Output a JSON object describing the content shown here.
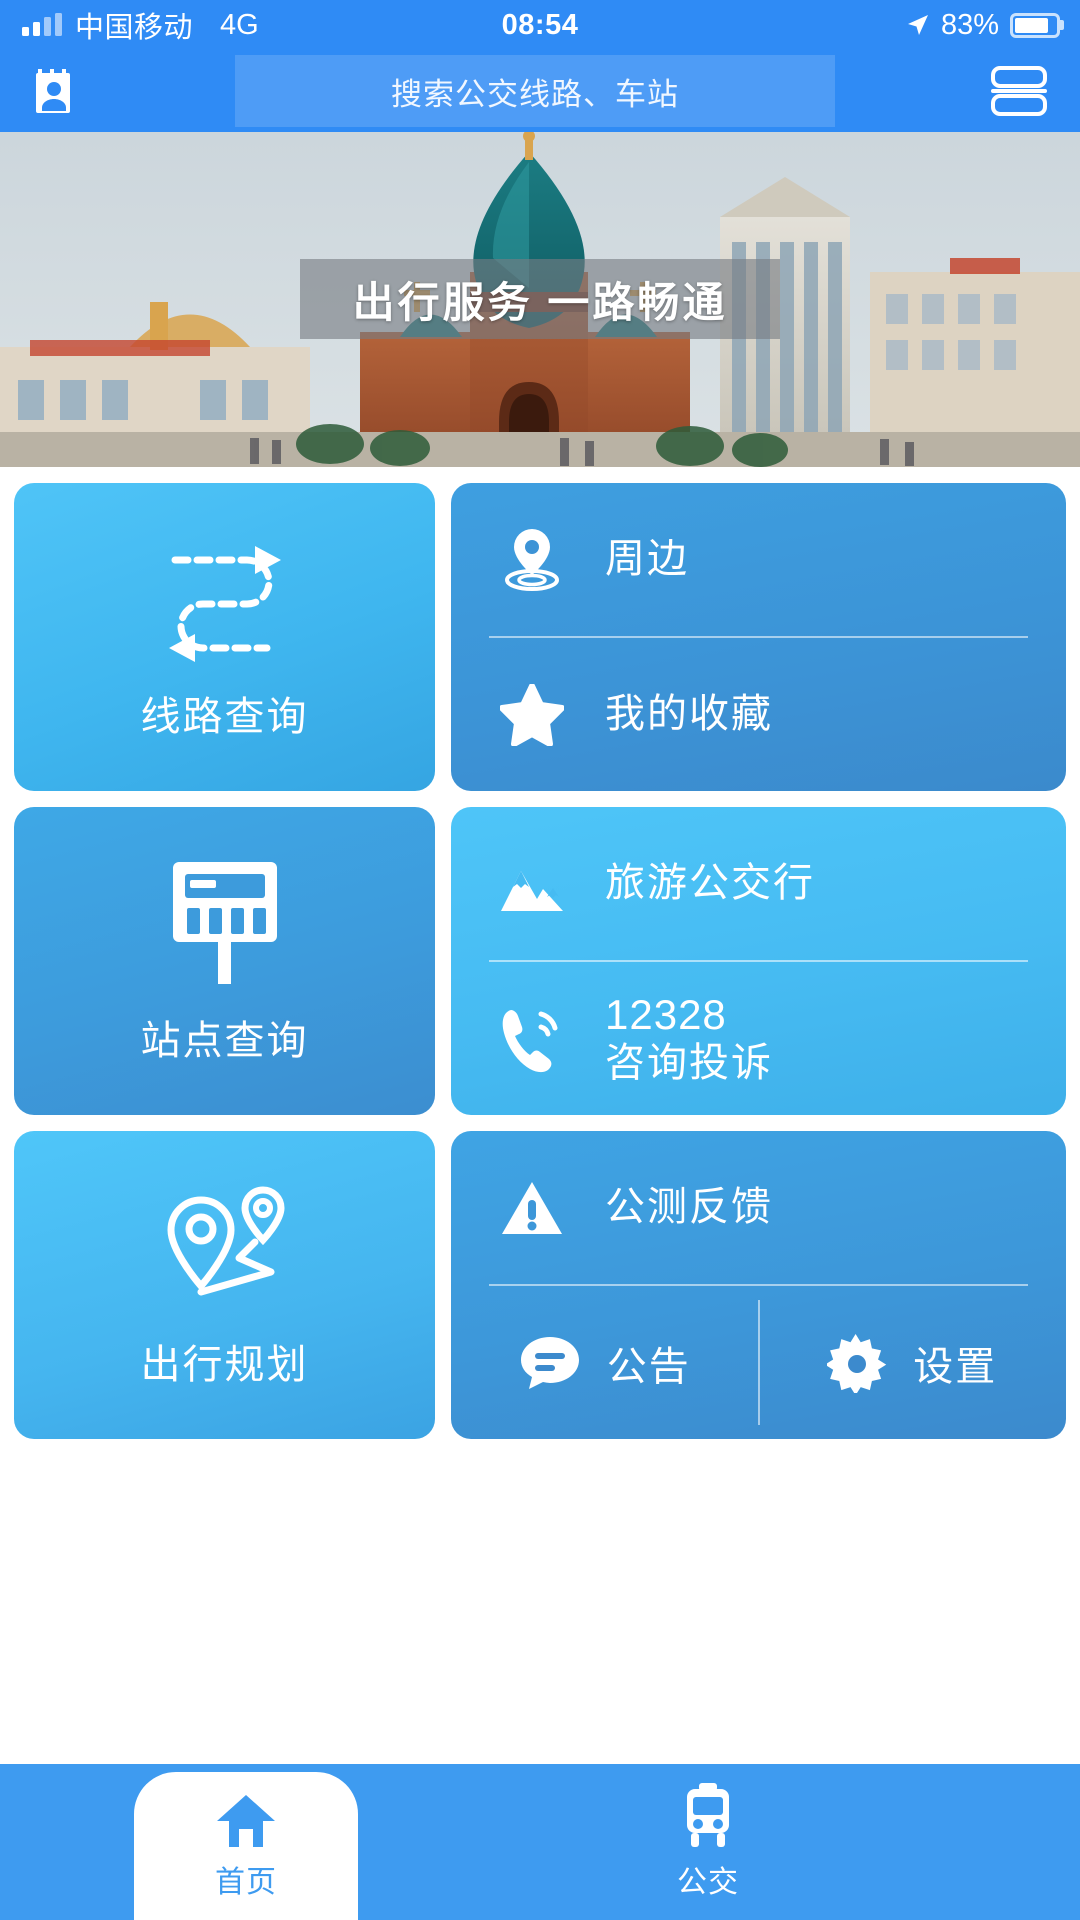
{
  "status_bar": {
    "carrier": "中国移动",
    "network": "4G",
    "time": "08:54",
    "battery_percent": "83%",
    "signal_bars": 4,
    "battery_level": 83
  },
  "header": {
    "profile_icon": "id-card-icon",
    "menu_icon": "list-menu-icon",
    "search_placeholder": "搜索公交线路、车站"
  },
  "banner": {
    "caption": "出行服务  一路畅通",
    "image_subject": "harbin-saint-sophia-cathedral"
  },
  "tiles": {
    "route_query": {
      "label": "线路查询",
      "icon": "s-route-dashed-icon"
    },
    "nearby": {
      "label": "周边",
      "icon": "location-pin-ripple-icon"
    },
    "favorites": {
      "label": "我的收藏",
      "icon": "star-icon"
    },
    "station_query": {
      "label": "站点查询",
      "icon": "bus-stop-sign-icon"
    },
    "tour_bus": {
      "label": "旅游公交行",
      "icon": "mountain-icon"
    },
    "hotline": {
      "number": "12328",
      "label": "咨询投诉",
      "icon": "phone-ring-icon"
    },
    "beta_feedback": {
      "label": "公测反馈",
      "icon": "warning-triangle-icon"
    },
    "announcements": {
      "label": "公告",
      "icon": "chat-bubble-icon"
    },
    "settings": {
      "label": "设置",
      "icon": "gear-icon"
    }
  },
  "bottom_nav": {
    "items": [
      {
        "label": "首页",
        "icon": "home-icon",
        "active": true
      },
      {
        "label": "公交",
        "icon": "bus-icon",
        "active": false
      }
    ]
  },
  "colors": {
    "brand_blue": "#2F8BF5",
    "nav_blue": "#3E9BF0",
    "tile_light": "#4FC4F7",
    "tile_deep": "#3E9FE0",
    "white": "#FFFFFF"
  }
}
